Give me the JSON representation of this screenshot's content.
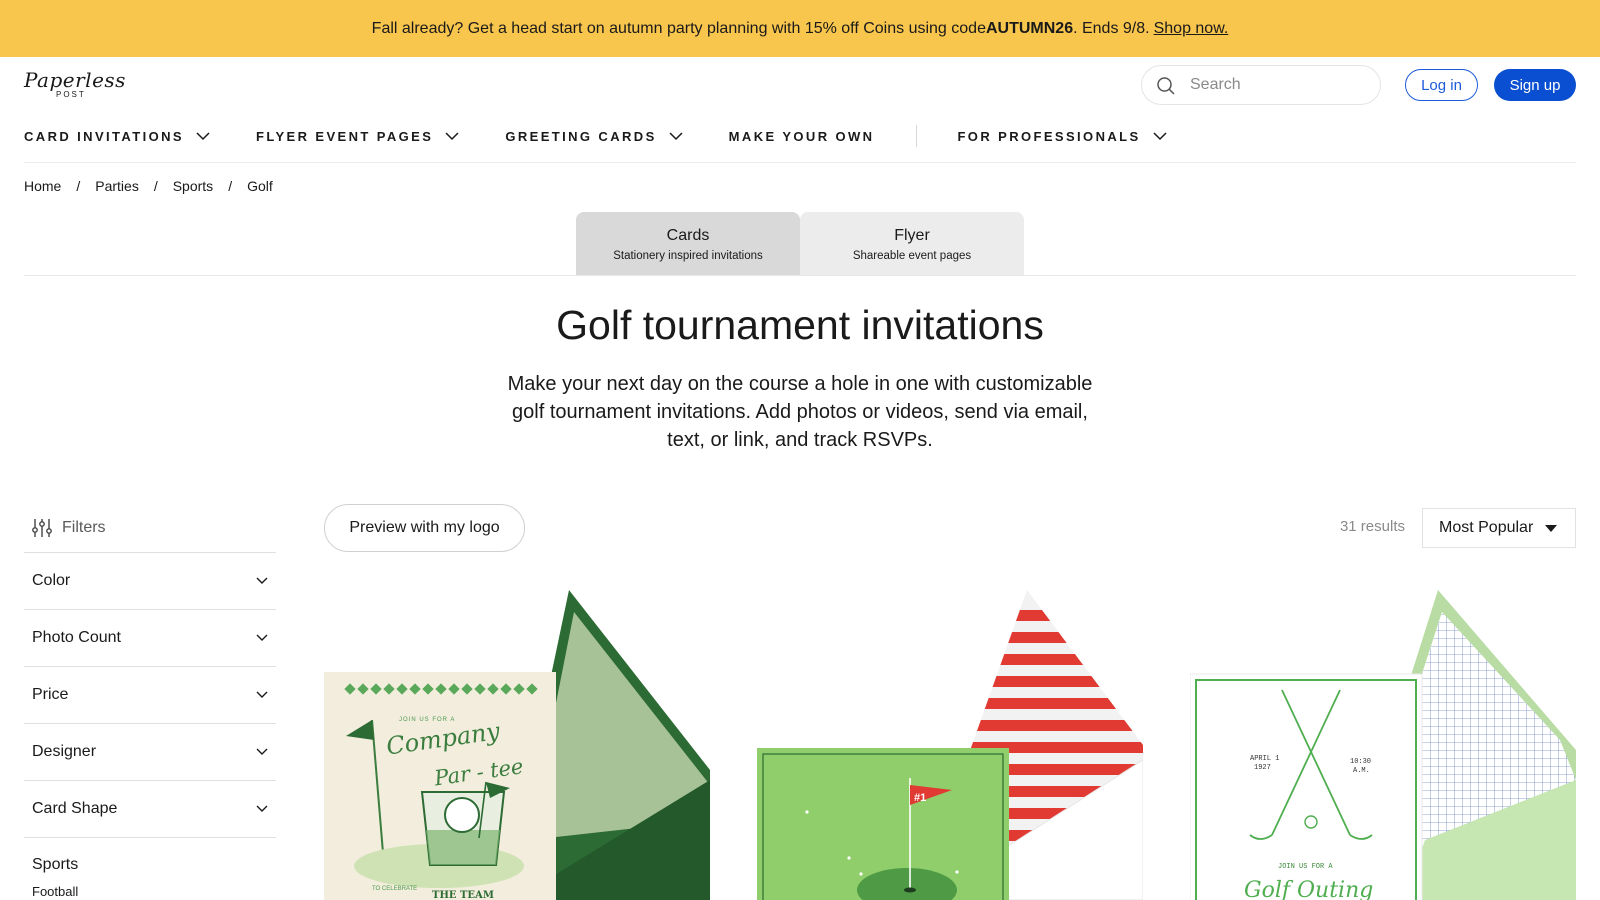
{
  "promo": {
    "text_before": "Fall already? Get a head start on autumn party planning with 15% off Coins using code ",
    "code": "AUTUMN26",
    "text_after": ". Ends 9/8.",
    "link": "Shop now."
  },
  "header": {
    "logo_script": "Paperless",
    "logo_sub": "POST",
    "search_placeholder": "Search",
    "login": "Log in",
    "signup": "Sign up"
  },
  "nav": {
    "items": [
      {
        "label": "CARD INVITATIONS"
      },
      {
        "label": "FLYER EVENT PAGES"
      },
      {
        "label": "GREETING CARDS"
      },
      {
        "label": "MAKE YOUR OWN"
      },
      {
        "label": "FOR PROFESSIONALS"
      }
    ]
  },
  "breadcrumb": [
    "Home",
    "Parties",
    "Sports",
    "Golf"
  ],
  "tabs": [
    {
      "title": "Cards",
      "subtitle": "Stationery inspired invitations"
    },
    {
      "title": "Flyer",
      "subtitle": "Shareable event pages"
    }
  ],
  "page": {
    "title": "Golf tournament invitations",
    "intro": "Make your next day on the course a hole in one with customizable golf tournament invitations. Add photos or videos, send via email, text, or link, and track RSVPs."
  },
  "filters": {
    "heading": "Filters",
    "facets": [
      "Color",
      "Photo Count",
      "Price",
      "Designer",
      "Card Shape"
    ],
    "category_title": "Sports",
    "category_items": [
      "Football"
    ]
  },
  "toolbar": {
    "preview_button": "Preview with my logo",
    "results": "31 results",
    "sort": "Most Popular"
  },
  "cards": [
    {
      "line1": "JOIN US FOR A",
      "title_a": "Company",
      "title_b": "Par - tee",
      "line2": "TO CELEBRATE",
      "line3": "THE TEAM"
    },
    {
      "flag": "#1"
    },
    {
      "date_left_a": "APRIL 1",
      "date_left_b": "1927",
      "date_right_a": "10:30",
      "date_right_b": "A.M.",
      "line1": "JOIN US FOR A",
      "title": "Golf Outing"
    }
  ],
  "colors": {
    "promo_bg": "#f8c54d",
    "accent_blue": "#0a4fd1",
    "card_green_dark": "#2c6b34",
    "card_green_light": "#8fce6a",
    "stripe_red": "#e03a32"
  }
}
